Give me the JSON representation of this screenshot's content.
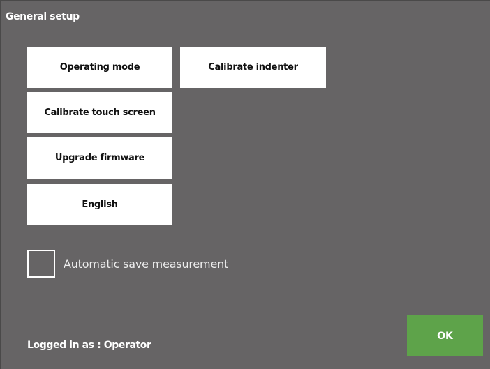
{
  "header": {
    "title": "General setup"
  },
  "menu": {
    "operating_mode": "Operating mode",
    "calibrate_indenter": "Calibrate indenter",
    "calibrate_touch_screen": "Calibrate touch screen",
    "upgrade_firmware": "Upgrade firmware",
    "language": "English"
  },
  "options": {
    "auto_save_label": "Automatic save measurement",
    "auto_save_checked": false
  },
  "footer": {
    "login_status": "Logged in as : Operator",
    "ok_label": "OK"
  },
  "colors": {
    "background": "#666465",
    "button": "#ffffff",
    "ok_button": "#5ea34a"
  }
}
